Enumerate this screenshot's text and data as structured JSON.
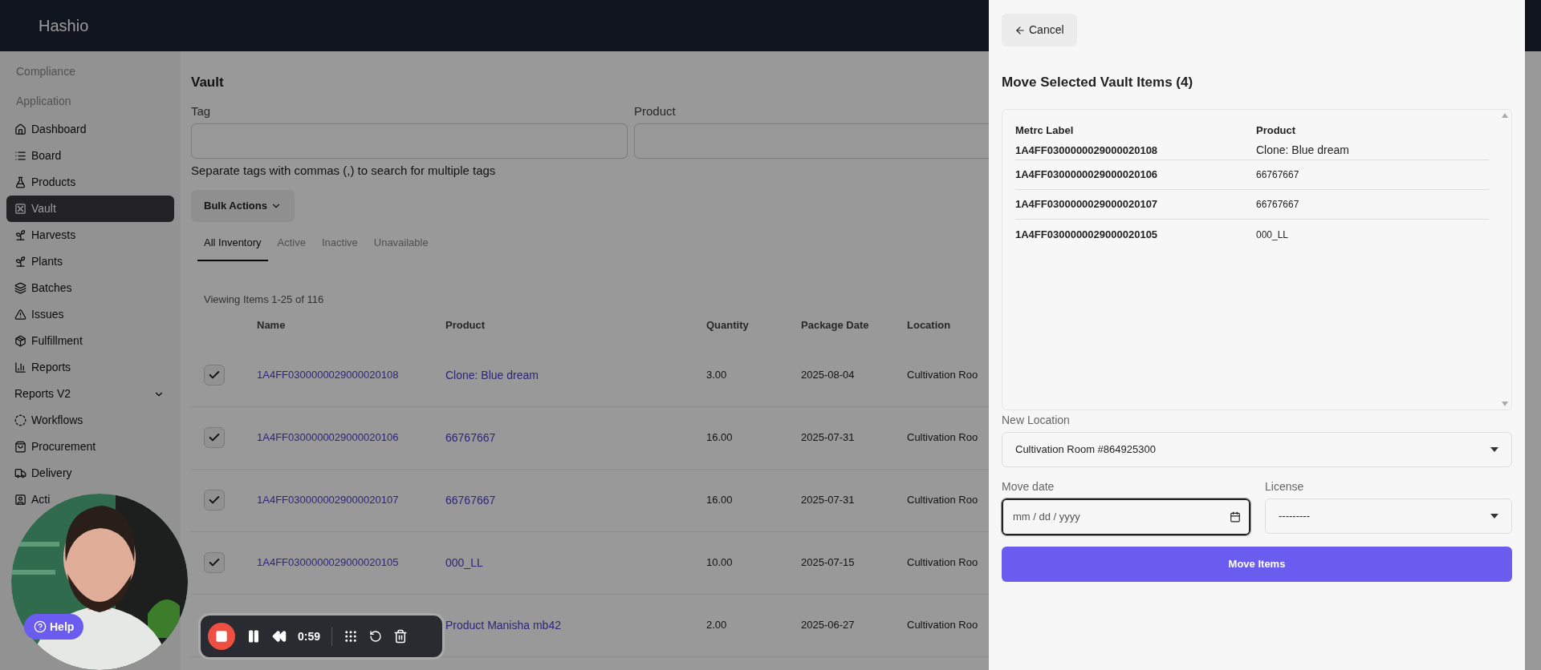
{
  "header": {
    "brand": "Hashio"
  },
  "sidebar": {
    "sections": [
      "Compliance",
      "Application"
    ],
    "items": [
      {
        "label": "Dashboard",
        "kind": "link",
        "selected": false
      },
      {
        "label": "Board",
        "kind": "link",
        "selected": false
      },
      {
        "label": "Products",
        "kind": "link",
        "selected": false
      },
      {
        "label": "Vault",
        "kind": "link",
        "selected": true
      },
      {
        "label": "Harvests",
        "kind": "link",
        "selected": false
      },
      {
        "label": "Plants",
        "kind": "link",
        "selected": false
      },
      {
        "label": "Batches",
        "kind": "link",
        "selected": false
      },
      {
        "label": "Issues",
        "kind": "link",
        "selected": false
      },
      {
        "label": "Fulfillment",
        "kind": "link",
        "selected": false
      },
      {
        "label": "Reports",
        "kind": "link",
        "selected": false
      },
      {
        "label": "Reports V2",
        "kind": "group",
        "selected": false
      },
      {
        "label": "Workflows",
        "kind": "link",
        "selected": false
      },
      {
        "label": "Procurement",
        "kind": "link",
        "selected": false
      },
      {
        "label": "Delivery",
        "kind": "link",
        "selected": false
      },
      {
        "label": "Acti",
        "kind": "link",
        "selected": false
      }
    ]
  },
  "main": {
    "title": "Vault",
    "filters": {
      "tag_label": "Tag",
      "product_label": "Product",
      "hint": "Separate tags with commas (,) to search for multiple tags"
    },
    "bulk_actions": "Bulk Actions",
    "tabs": [
      {
        "label": "All Inventory",
        "selected": true
      },
      {
        "label": "Active",
        "selected": false
      },
      {
        "label": "Inactive",
        "selected": false
      },
      {
        "label": "Unavailable",
        "selected": false
      }
    ],
    "count": "Viewing Items 1-25 of 116",
    "table": {
      "columns": [
        "Name",
        "Product",
        "Quantity",
        "Package Date",
        "Location"
      ],
      "rows": [
        {
          "checked": true,
          "name": "1A4FF0300000029000020108",
          "product": "Clone: Blue dream",
          "quantity": "3.00",
          "date": "2025-08-04",
          "location": "Cultivation Roo"
        },
        {
          "checked": true,
          "name": "1A4FF0300000029000020106",
          "product": "66767667",
          "quantity": "16.00",
          "date": "2025-07-31",
          "location": "Cultivation Roo"
        },
        {
          "checked": true,
          "name": "1A4FF0300000029000020107",
          "product": "66767667",
          "quantity": "16.00",
          "date": "2025-07-31",
          "location": "Cultivation Roo"
        },
        {
          "checked": true,
          "name": "1A4FF0300000029000020105",
          "product": "000_LL",
          "quantity": "10.00",
          "date": "2025-07-15",
          "location": "Cultivation Roo"
        },
        {
          "product": "Product Manisha mb42",
          "quantity": "2.00",
          "date": "2025-06-27",
          "location": "Cultivation Roo"
        }
      ]
    }
  },
  "panel": {
    "cancel": "Cancel",
    "title": "Move Selected Vault Items (4)",
    "items": {
      "columns": [
        "Metrc Label",
        "Product"
      ],
      "rows": [
        {
          "label": "1A4FF0300000029000020108",
          "product": "Clone: Blue dream"
        },
        {
          "label": "1A4FF0300000029000020106",
          "product": "66767667"
        },
        {
          "label": "1A4FF0300000029000020107",
          "product": "66767667"
        },
        {
          "label": "1A4FF0300000029000020105",
          "product": "000_LL"
        }
      ]
    },
    "new_location": {
      "label": "New Location",
      "value": "Cultivation Room #864925300"
    },
    "move_date": {
      "label": "Move date",
      "placeholder": "mm / dd / yyyy"
    },
    "license": {
      "label": "License",
      "value": "---------"
    },
    "submit": "Move Items"
  },
  "recorder": {
    "time": "0:59"
  },
  "help": {
    "label": "Help"
  }
}
